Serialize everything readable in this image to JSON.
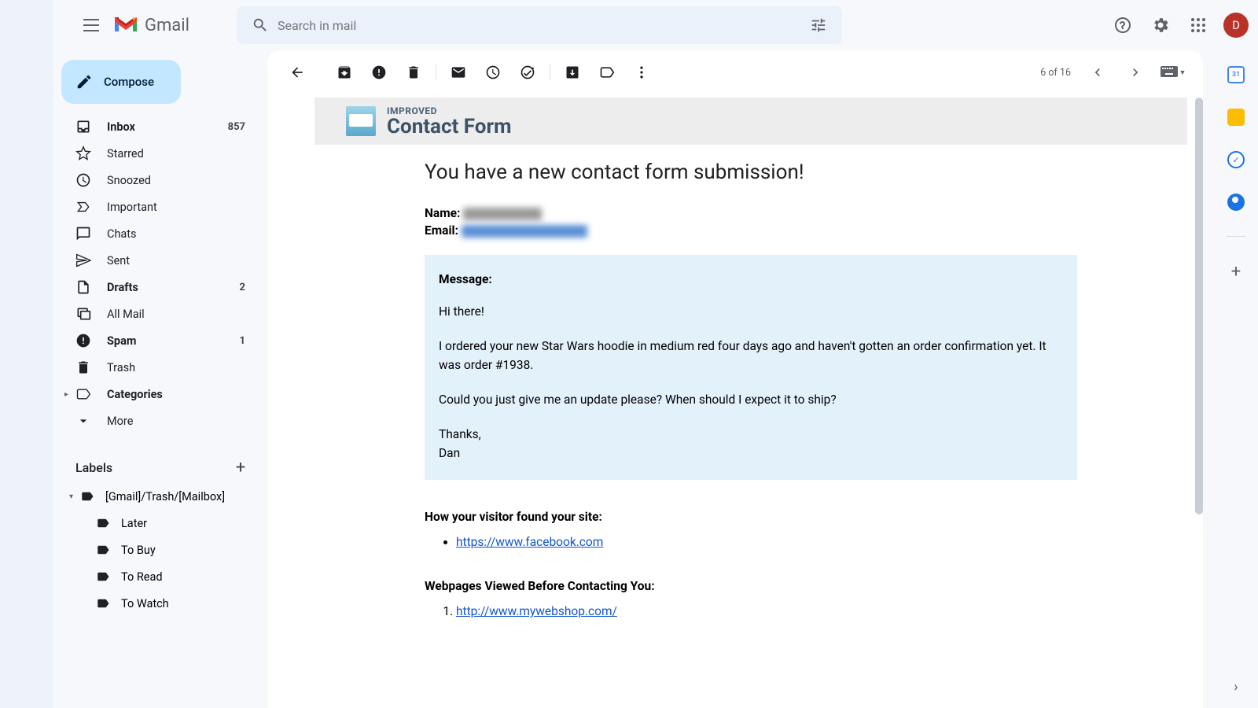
{
  "header": {
    "product": "Gmail",
    "search_placeholder": "Search in mail",
    "avatar_initial": "D"
  },
  "compose_label": "Compose",
  "nav": [
    {
      "label": "Inbox",
      "count": "857",
      "bold": true,
      "icon": "inbox"
    },
    {
      "label": "Starred",
      "count": "",
      "bold": false,
      "icon": "star"
    },
    {
      "label": "Snoozed",
      "count": "",
      "bold": false,
      "icon": "clock"
    },
    {
      "label": "Important",
      "count": "",
      "bold": false,
      "icon": "important"
    },
    {
      "label": "Chats",
      "count": "",
      "bold": false,
      "icon": "chat"
    },
    {
      "label": "Sent",
      "count": "",
      "bold": false,
      "icon": "sent"
    },
    {
      "label": "Drafts",
      "count": "2",
      "bold": true,
      "icon": "draft"
    },
    {
      "label": "All Mail",
      "count": "",
      "bold": false,
      "icon": "allmail"
    },
    {
      "label": "Spam",
      "count": "1",
      "bold": true,
      "icon": "spam"
    },
    {
      "label": "Trash",
      "count": "",
      "bold": false,
      "icon": "trash"
    },
    {
      "label": "Categories",
      "count": "",
      "bold": true,
      "icon": "categories"
    },
    {
      "label": "More",
      "count": "",
      "bold": false,
      "icon": "more"
    }
  ],
  "labels_title": "Labels",
  "labels": [
    {
      "text": "[Gmail]/Trash/[Mailbox]",
      "expandable": true
    },
    {
      "text": "Later",
      "sub": true
    },
    {
      "text": "To Buy",
      "sub": true
    },
    {
      "text": "To Read",
      "sub": true
    },
    {
      "text": "To Watch",
      "sub": true
    }
  ],
  "toolbar": {
    "page_of": "6 of 16"
  },
  "email": {
    "banner_sup": "IMPROVED",
    "banner_title": "Contact Form",
    "subject": "You have a new contact form submission!",
    "name_label": "Name:",
    "email_label": "Email:",
    "message_label": "Message:",
    "msg_p1": "Hi there!",
    "msg_p2": "I ordered your new Star Wars hoodie in medium red four days ago and haven't gotten an order confirmation yet. It was order #1938.",
    "msg_p3": "Could you just give me an update please? When should I expect it to ship?",
    "msg_p4": "Thanks,",
    "msg_p5": "Dan",
    "found_heading": "How your visitor found your site:",
    "found_link": "https://www.facebook.com",
    "viewed_heading": "Webpages Viewed Before Contacting You:",
    "viewed_link1": "http://www.mywebshop.com/"
  }
}
